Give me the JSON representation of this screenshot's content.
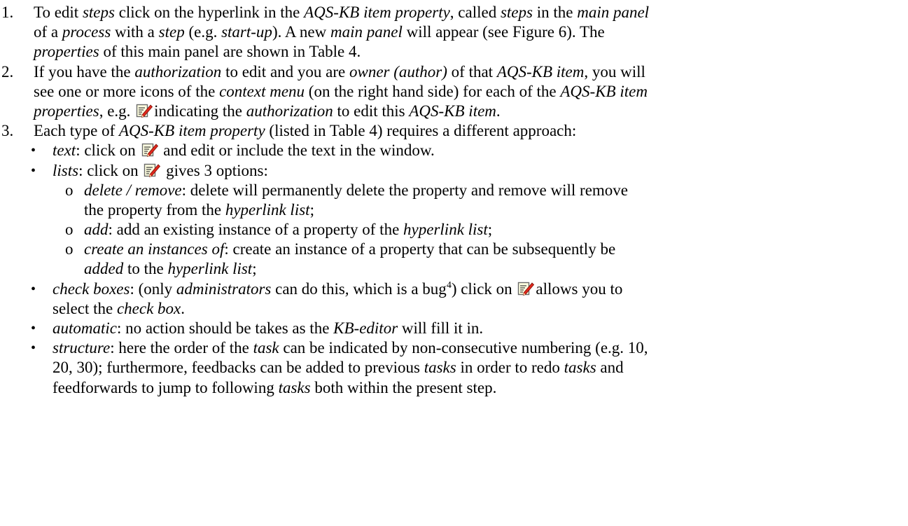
{
  "icon": {
    "name": "edit-icon",
    "paper_color": "#fefee0",
    "border_color": "#6a6a6a",
    "pencil_color": "#e0281c",
    "line_color": "#3a3a3a"
  },
  "steps": [
    {
      "number": "1.",
      "lines": [
        [
          "To edit ",
          {
            "i": "steps"
          },
          " click on the hyperlink in the ",
          {
            "i": "AQS-KB item property"
          },
          ", called ",
          {
            "i": "steps"
          },
          " in the ",
          {
            "i": "main panel"
          }
        ],
        [
          "of a ",
          {
            "i": "process"
          },
          " with a ",
          {
            "i": "step"
          },
          " (e.g. ",
          {
            "i": "start-up"
          },
          "). A new ",
          {
            "i": "main panel"
          },
          " will appear (see Figure 6). The"
        ],
        [
          {
            "i": "properties"
          },
          " of this main panel are shown in Table 4."
        ]
      ]
    },
    {
      "number": "2.",
      "lines": [
        [
          "If you have the ",
          {
            "i": "authorization"
          },
          " to edit and you are ",
          {
            "i": "owner (author)"
          },
          " of that ",
          {
            "i": "AQS-KB item"
          },
          ", you will"
        ],
        [
          "see one or more icons of the ",
          {
            "i": "context menu"
          },
          " (on the right hand side) for each of the ",
          {
            "i": "AQS-KB item"
          }
        ],
        [
          {
            "i": "properties"
          },
          ", e.g. ",
          {
            "icon": true
          },
          "indicating the ",
          {
            "i": "authorization"
          },
          " to edit this ",
          {
            "i": "AQS-KB item"
          },
          "."
        ]
      ]
    },
    {
      "number": "3.",
      "lines": [
        [
          "Each type of ",
          {
            "i": "AQS-KB item property"
          },
          " (listed in Table 4) requires a different approach:"
        ]
      ]
    }
  ],
  "bullets": [
    {
      "kind": "b1",
      "lines": [
        [
          {
            "i": "text"
          },
          ": click on ",
          {
            "icon": true
          },
          " and edit or include the text in the window."
        ]
      ]
    },
    {
      "kind": "b1",
      "lines": [
        [
          {
            "i": "lists"
          },
          ": click on ",
          {
            "icon": true
          },
          " gives 3 options:"
        ]
      ]
    },
    {
      "kind": "b2",
      "lines": [
        [
          {
            "i": "delete / remove"
          },
          ": delete will permanently delete the property and remove will remove"
        ],
        [
          "the property from the ",
          {
            "i": "hyperlink list"
          },
          ";"
        ]
      ]
    },
    {
      "kind": "b2",
      "lines": [
        [
          {
            "i": "add"
          },
          ": add an existing instance of a property of the ",
          {
            "i": "hyperlink list"
          },
          ";"
        ]
      ]
    },
    {
      "kind": "b2",
      "lines": [
        [
          {
            "i": "create an instances of"
          },
          ": create an instance of a property that can be subsequently be"
        ],
        [
          {
            "i": "added"
          },
          " to the ",
          {
            "i": "hyperlink list"
          },
          ";"
        ]
      ]
    },
    {
      "kind": "b1",
      "lines": [
        [
          {
            "i": "check boxes"
          },
          ": (only ",
          {
            "i": "administrators"
          },
          " can do this",
          {
            "i": ","
          },
          " which is a bug",
          {
            "sup": "4"
          },
          ") click on ",
          {
            "icon": true
          },
          "allows you to"
        ],
        [
          "select the ",
          {
            "i": "check box"
          },
          "."
        ]
      ]
    },
    {
      "kind": "b1",
      "lines": [
        [
          {
            "i": "automatic"
          },
          ": no action should be takes as the ",
          {
            "i": "KB-editor"
          },
          " will fill it in."
        ]
      ]
    },
    {
      "kind": "b1",
      "lines": [
        [
          {
            "i": "structure"
          },
          ": here the order of the ",
          {
            "i": "task"
          },
          " can be indicated by non-consecutive numbering (e.g. 10,"
        ],
        [
          "20, 30); furthermore, feedbacks can be added to previous ",
          {
            "i": "tasks"
          },
          " in order to redo ",
          {
            "i": "tasks"
          },
          " and"
        ],
        [
          "feedforwards to jump to following ",
          {
            "i": "tasks"
          },
          " both within the present step."
        ]
      ]
    }
  ],
  "bullet_glyphs": {
    "b1": "•",
    "b2": "o"
  }
}
